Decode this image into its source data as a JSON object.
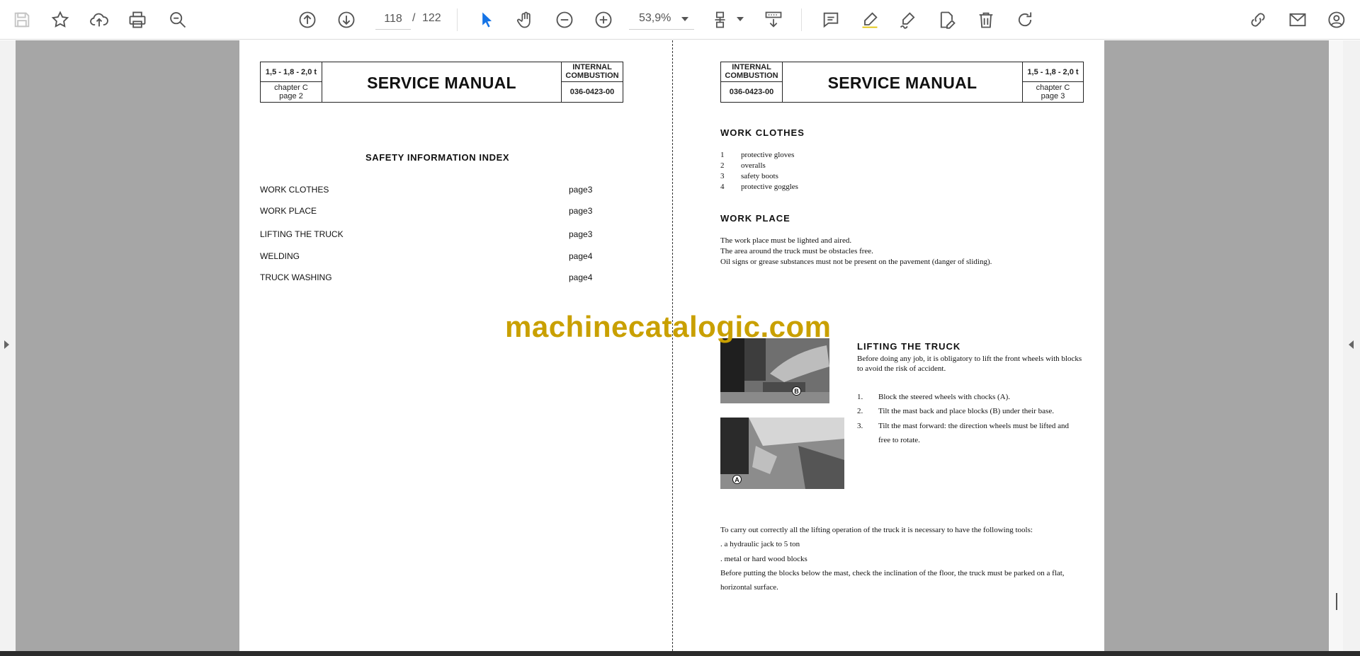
{
  "toolbar": {
    "page_current": "118",
    "page_separator": "/",
    "page_total": "122",
    "zoom": "53,9%",
    "icons": [
      "save-icon",
      "bookmark-star-icon",
      "upload-cloud-icon",
      "print-icon",
      "find-zoom-icon",
      "prev-page-icon",
      "next-page-icon",
      "zoom-out-icon",
      "zoom-in-icon",
      "select-cursor-icon",
      "hand-pan-icon",
      "page-fit-icon",
      "scroll-mode-icon",
      "comment-icon",
      "highlight-icon",
      "sign-icon",
      "edit-pdf-icon",
      "delete-icon",
      "rotate-icon",
      "share-link-icon",
      "email-icon",
      "account-icon"
    ]
  },
  "left_page": {
    "header": {
      "tonnage": "1,5 - 1,8 - 2,0 t",
      "chapter": "chapter C",
      "page": "page 2",
      "title": "SERVICE MANUAL",
      "type_line1": "INTERNAL",
      "type_line2": "COMBUSTION",
      "code": "036-0423-00"
    },
    "index_title": "SAFETY INFORMATION INDEX",
    "index": [
      {
        "label": "WORK CLOTHES",
        "page": "page3"
      },
      {
        "label": "WORK PLACE",
        "page": "page3"
      },
      {
        "label": "LIFTING THE TRUCK",
        "page": "page3"
      },
      {
        "label": "WELDING",
        "page": "page4"
      },
      {
        "label": "TRUCK WASHING",
        "page": "page4"
      }
    ]
  },
  "right_page": {
    "header": {
      "type_line1": "INTERNAL",
      "type_line2": "COMBUSTION",
      "code": "036-0423-00",
      "title": "SERVICE MANUAL",
      "tonnage": "1,5 - 1,8 - 2,0 t",
      "chapter": "chapter C",
      "page": "page 3"
    },
    "work_clothes": {
      "title": "WORK  CLOTHES",
      "items": [
        {
          "num": "1",
          "text": "protective gloves"
        },
        {
          "num": "2",
          "text": "overalls"
        },
        {
          "num": "3",
          "text": "safety boots"
        },
        {
          "num": "4",
          "text": "protective goggles"
        }
      ]
    },
    "work_place": {
      "title": "WORK  PLACE",
      "lines": [
        "The work place must be lighted and aired.",
        "The area around the truck must be obstacles free.",
        "Oil signs or grease substances must not be present on the pavement (danger of sliding)."
      ]
    },
    "lifting": {
      "title": "LIFTING  THE  TRUCK",
      "intro_line1": "Before doing any job, it is obligatory to lift the front wheels with blocks",
      "intro_line2": "to avoid the risk of accident.",
      "steps": [
        {
          "num": "1.",
          "text": "Block the steered wheels with chocks (A)."
        },
        {
          "num": "2.",
          "text": "Tilt the mast back and place blocks (B) under their base."
        },
        {
          "num": "3.",
          "text": "Tilt the mast forward: the direction wheels must be lifted and"
        }
      ],
      "step3_cont": "free to rotate.",
      "photo_label_b": "B",
      "photo_label_a": "A"
    },
    "tools": {
      "lines": [
        "To carry out correctly all the lifting operation of the truck it is necessary to have the following tools:",
        ". a hydraulic jack to 5 ton",
        ". metal or hard wood blocks",
        "Before putting the blocks below the mast, check the inclination of the floor, the truck must be parked on a flat,",
        "horizontal surface."
      ]
    }
  },
  "watermark": "machinecatalogic.com",
  "colors": {
    "accent": "#1473e6",
    "watermark": "#c9a000",
    "viewer_bg": "#a6a6a6"
  }
}
